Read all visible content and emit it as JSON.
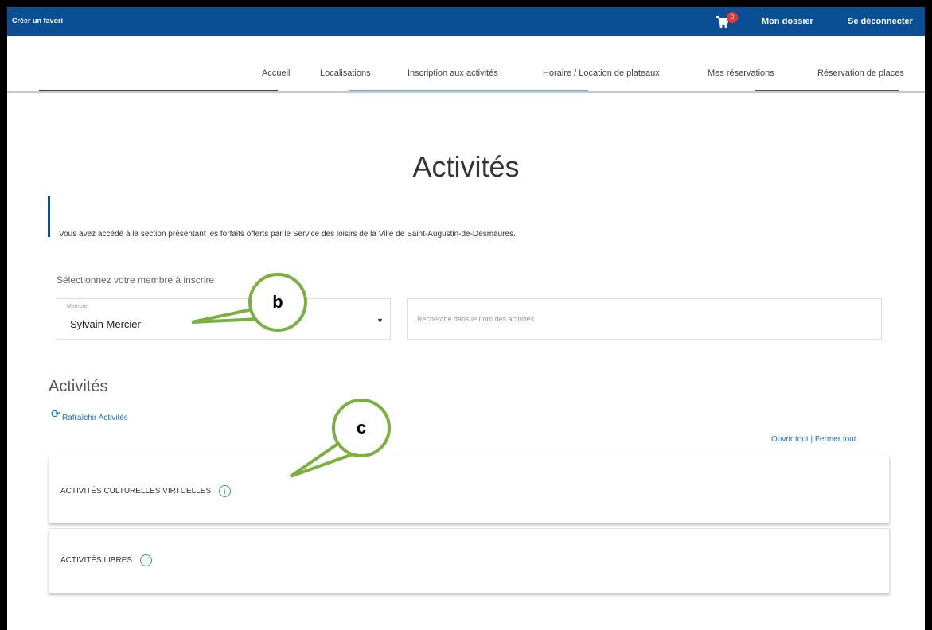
{
  "topbar": {
    "favorite_link": "Créer un favori",
    "cart_count": "0",
    "my_file": "Mon dossier",
    "logout": "Se déconnecter"
  },
  "nav": {
    "items": [
      "Accueil",
      "Localisations",
      "Inscription aux activités",
      "Horaire / Location de plateaux",
      "Mes réservations",
      "Réservation de places"
    ]
  },
  "page": {
    "title": "Activités",
    "intro": "Vous avez accédé à la section présentant les forfaits offerts par le Service des loisirs de la Ville de Saint-Augustin-de-Desmaures."
  },
  "member_select": {
    "prompt": "Sélectionnez votre membre à inscrire",
    "label": "Membre",
    "value": "Sylvain Mercier"
  },
  "search": {
    "placeholder": "Recherche dans le nom des activités"
  },
  "activities": {
    "heading": "Activités",
    "refresh": "Rafraîchir Activités",
    "toggle_all": "Ouvrir tout | Fermer tout",
    "categories": [
      "ACTIVITÉS CULTURELLES VIRTUELLES",
      "ACTIVITÉS LIBRES"
    ]
  },
  "annotations": {
    "b": "b",
    "c": "c"
  },
  "colors": {
    "topbar": "#0a4f94",
    "link": "#1a73c9",
    "callout": "#7bb041",
    "info_icon": "#3aa86b",
    "cart_badge": "#e53935"
  },
  "icons": [
    "cart-icon",
    "dropdown-caret-icon",
    "refresh-icon",
    "info-icon"
  ]
}
